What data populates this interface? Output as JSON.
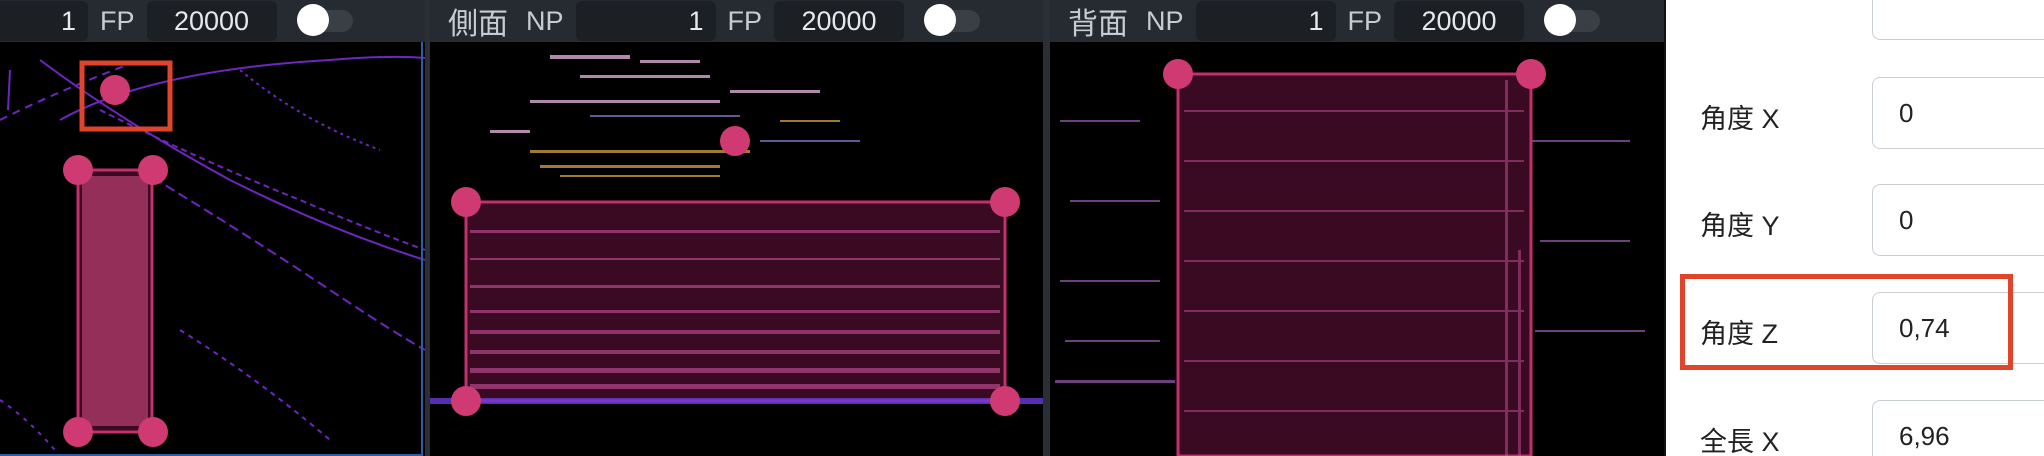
{
  "viewports": {
    "top": {
      "np_value": "1",
      "fp_label": "FP",
      "fp_value": "20000"
    },
    "side": {
      "title": "側面",
      "np_label": "NP",
      "np_value": "1",
      "fp_label": "FP",
      "fp_value": "20000"
    },
    "back": {
      "title": "背面",
      "np_label": "NP",
      "np_value": "1",
      "fp_label": "FP",
      "fp_value": "20000"
    }
  },
  "properties": [
    {
      "label": "角度 X",
      "value": "0"
    },
    {
      "label": "角度 Y",
      "value": "0"
    },
    {
      "label": "角度 Z",
      "value": "0,74"
    },
    {
      "label": "全長 X",
      "value": "6,96"
    }
  ],
  "colors": {
    "toolbar_bg": "#262b31",
    "box_stroke": "#c2306e",
    "box_fill": "#3a0a22",
    "handle": "#cf3a72",
    "highlight": "#e0452b",
    "active_frame": "#2d5ea8"
  },
  "icons": {
    "toggle": "toggle-switch-off"
  }
}
